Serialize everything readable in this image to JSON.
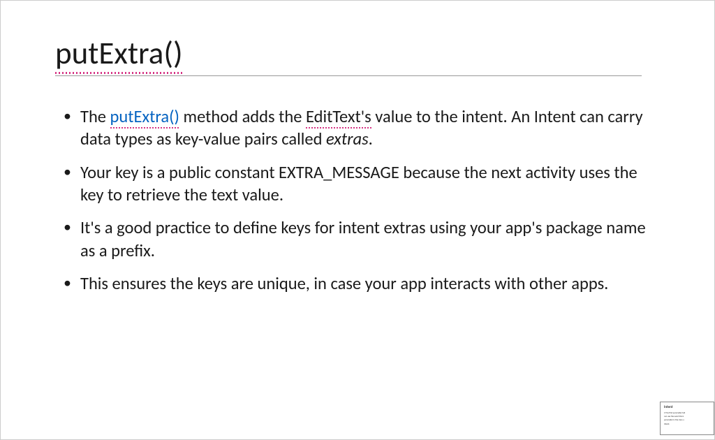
{
  "title": "putExtra()",
  "bullets": [
    {
      "prefix": "The ",
      "link": "putExtra()",
      "mid1": " method adds the ",
      "spell": "EditText's",
      "mid2": " value to the intent. An Intent can carry data types as key-value pairs called ",
      "italic": "extras",
      "suffix": "."
    },
    {
      "text": "Your key is a public constant EXTRA_MESSAGE because the next activity uses the key to retrieve the text value."
    },
    {
      "text": "It's a good practice to define keys for intent extras using your app's package name as a prefix."
    },
    {
      "text": "This ensures the keys are unique, in case your app interacts with other apps."
    }
  ],
  "thumbnail": {
    "title": "Intent",
    "line1": "• The first parameter tell",
    "line2": "can use the word this b",
    "line3": "parameter is the class a",
    "line4": "Intent."
  }
}
